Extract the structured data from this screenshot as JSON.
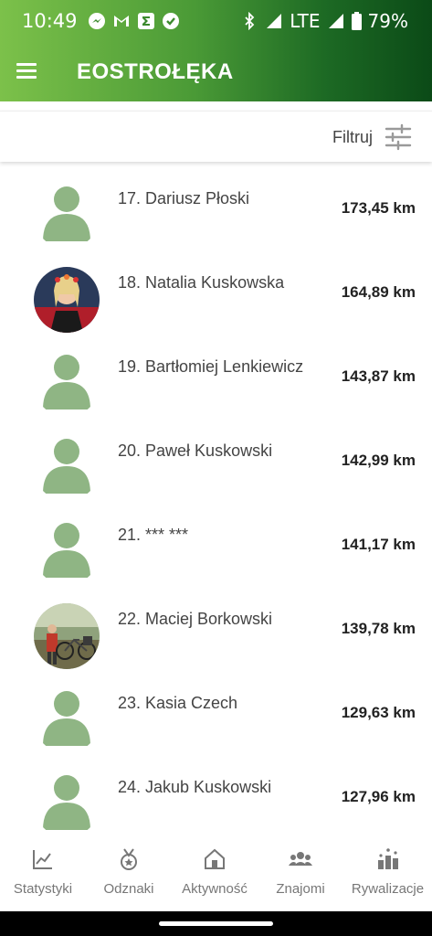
{
  "status_bar": {
    "time": "10:49",
    "network": "LTE",
    "battery": "79%",
    "notification_icons": [
      "messenger-icon",
      "gmail-icon",
      "sigma-app-icon",
      "check-shield-icon"
    ],
    "system_icons": [
      "bluetooth-icon",
      "signal-icon",
      "signal-icon",
      "battery-icon"
    ]
  },
  "app_bar": {
    "title": "EOSTROŁĘKA",
    "menu_icon": "hamburger-menu-icon"
  },
  "filter": {
    "label": "Filtruj",
    "icon": "sliders-icon"
  },
  "leaderboard": [
    {
      "name": "17. Dariusz Płoski",
      "distance": "173,45 km",
      "avatar": "default"
    },
    {
      "name": "18. Natalia Kuskowska",
      "distance": "164,89 km",
      "avatar": "photo"
    },
    {
      "name": "19. Bartłomiej Lenkiewicz",
      "distance": "143,87 km",
      "avatar": "default"
    },
    {
      "name": "20. Paweł Kuskowski",
      "distance": "142,99 km",
      "avatar": "default"
    },
    {
      "name": "21. *** ***",
      "distance": "141,17 km",
      "avatar": "default"
    },
    {
      "name": "22. Maciej Borkowski",
      "distance": "139,78 km",
      "avatar": "photo"
    },
    {
      "name": "23. Kasia Czech",
      "distance": "129,63 km",
      "avatar": "default"
    },
    {
      "name": "24. Jakub Kuskowski",
      "distance": "127,96 km",
      "avatar": "default"
    }
  ],
  "bottom_nav": [
    {
      "label": "Statystyki",
      "icon": "chart-icon"
    },
    {
      "label": "Odznaki",
      "icon": "medal-icon"
    },
    {
      "label": "Aktywność",
      "icon": "home-icon"
    },
    {
      "label": "Znajomi",
      "icon": "people-icon"
    },
    {
      "label": "Rywalizacje",
      "icon": "podium-icon"
    }
  ],
  "colors": {
    "gradient_start": "#7cc14a",
    "gradient_end": "#0b4a17",
    "avatar_placeholder": "#8fb584"
  }
}
